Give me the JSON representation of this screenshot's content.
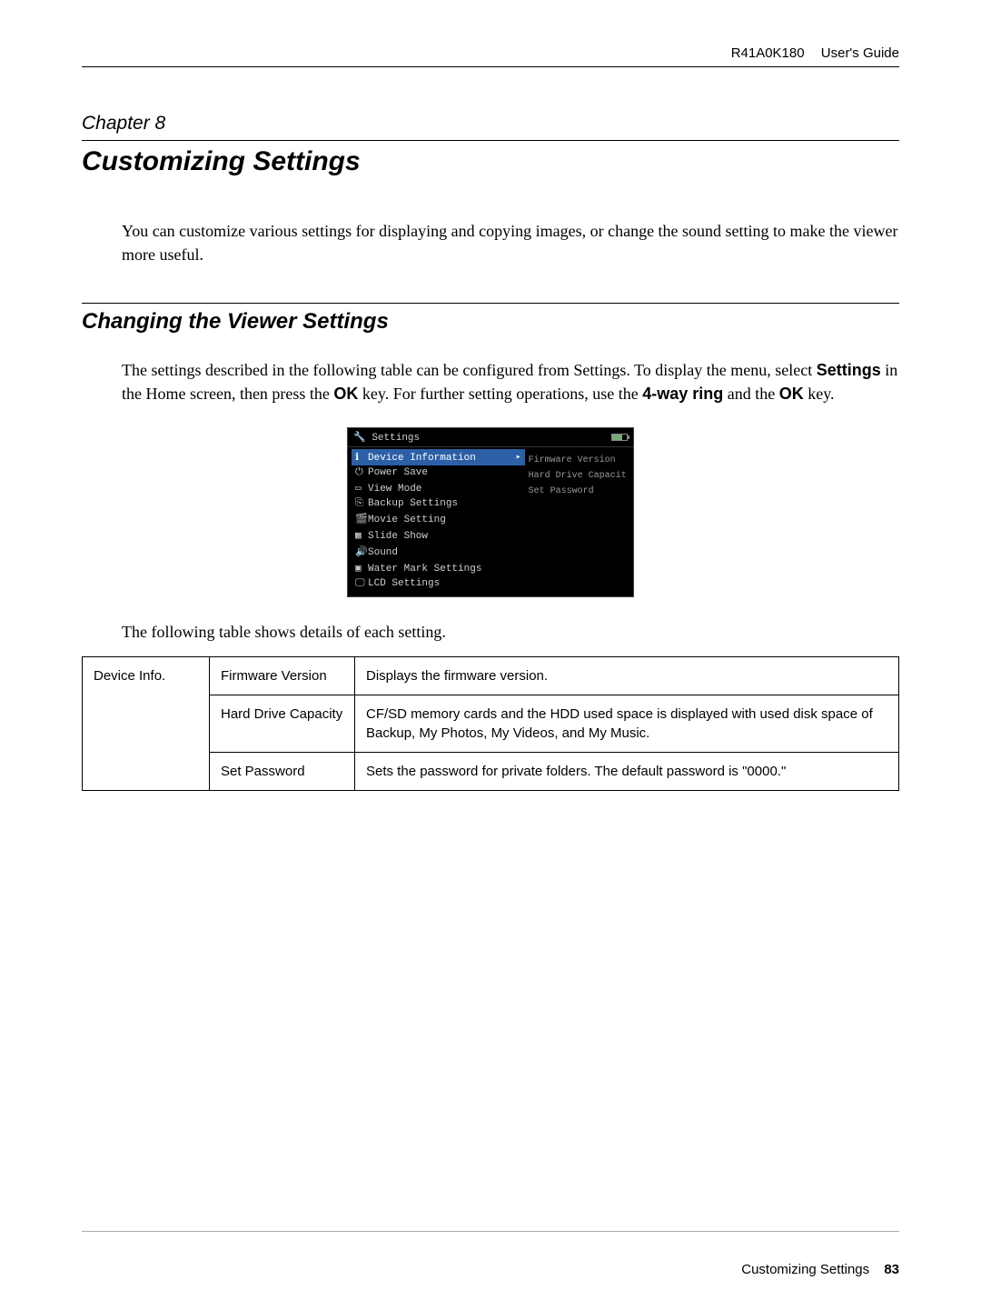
{
  "header": {
    "product": "R41A0K180",
    "doc": "User's Guide"
  },
  "chapter": {
    "label": "Chapter 8",
    "title": "Customizing Settings"
  },
  "intro": "You can customize various settings for displaying and copying images, or change the sound setting to make the viewer more useful.",
  "section": {
    "title": "Changing the Viewer Settings",
    "para_pre": "The settings described in the following table can be configured from Settings. To display the menu, select ",
    "kw1": "Settings",
    "mid1": " in the Home screen, then press the ",
    "kw2": "OK",
    "mid2": " key. For further setting operations, use the ",
    "kw3": "4-way ring",
    "mid3": " and the ",
    "kw4": "OK",
    "tail": " key."
  },
  "screenshot": {
    "title": "Settings",
    "left": [
      "Device Information",
      "Power Save",
      "View Mode",
      "Backup Settings",
      "Movie Setting",
      "Slide Show",
      "Sound",
      "Water Mark Settings",
      "LCD Settings"
    ],
    "right": [
      "Firmware Version",
      "Hard Drive Capacit",
      "Set Password"
    ]
  },
  "caption": "The following table shows details of each setting.",
  "table": {
    "col1": "Device Info.",
    "rows": [
      {
        "name": "Firmware Version",
        "desc": "Displays the firmware version."
      },
      {
        "name": "Hard Drive Capacity",
        "desc": "CF/SD memory cards and the HDD used space is displayed with used disk space of Backup, My Photos, My Videos, and My Music."
      },
      {
        "name": "Set Password",
        "desc": "Sets the password for private folders. The default password is \"0000.\""
      }
    ]
  },
  "footer": {
    "section": "Customizing Settings",
    "page": "83"
  }
}
